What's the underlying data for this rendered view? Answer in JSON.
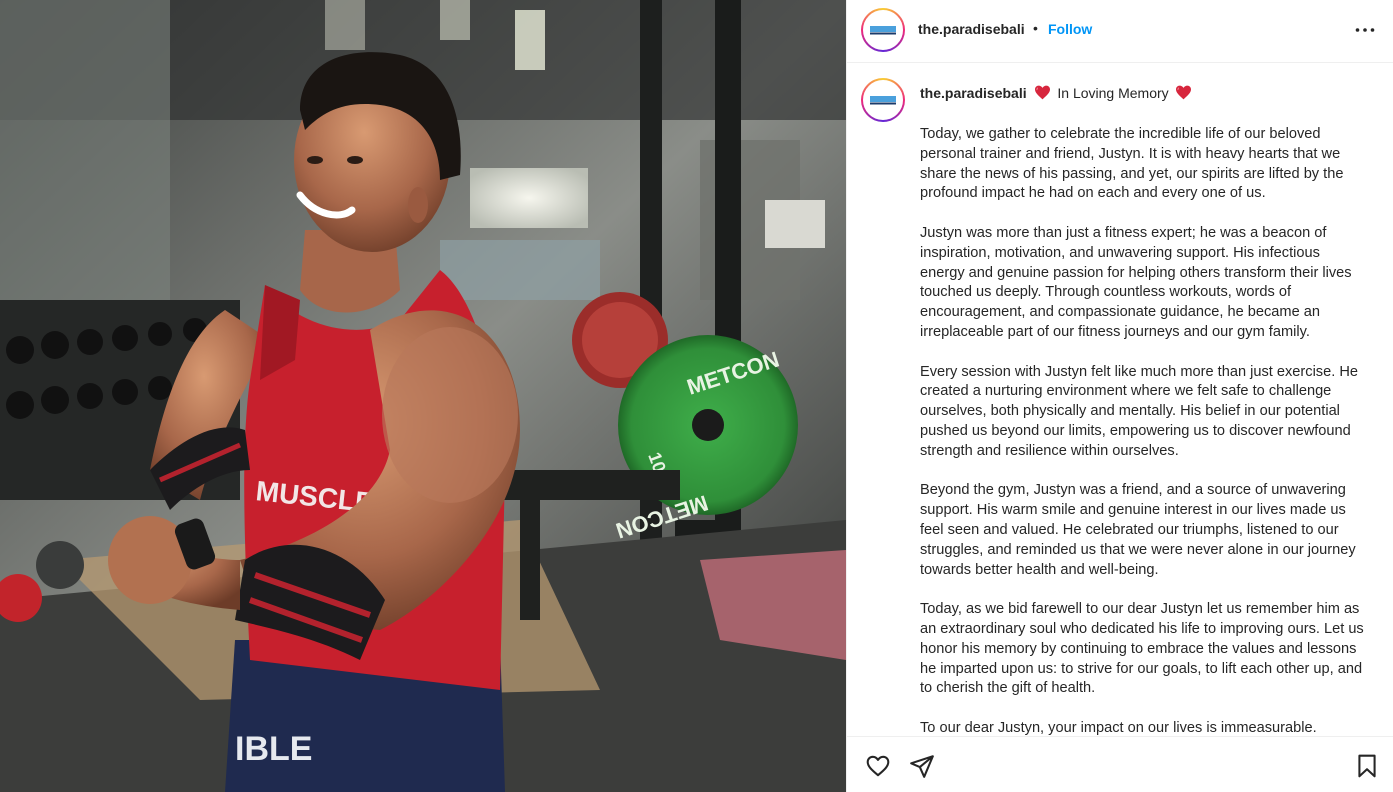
{
  "post": {
    "username": "the.paradisebali",
    "separator": "•",
    "follow_label": "Follow",
    "avatar_logo_text": "PARADISE",
    "photo_shirt_text": "MUSCLE",
    "photo_shorts_text": "IBLE",
    "photo_plate_text": "METCON",
    "photo_plate_number": "10",
    "caption": {
      "username": "the.paradisebali",
      "title": "In Loving Memory",
      "paragraphs": [
        "Today, we gather to celebrate the incredible life of our beloved personal trainer and friend, Justyn. It is with heavy hearts that we share the news of his passing, and yet, our spirits are lifted by the profound impact he had on each and every one of us.",
        "Justyn was more than just a fitness expert; he was a beacon of inspiration, motivation, and unwavering support. His infectious energy and genuine passion for helping others transform their lives touched us deeply. Through countless workouts, words of encouragement, and compassionate guidance, he became an irreplaceable part of our fitness journeys and our gym family.",
        "Every session with Justyn felt like much more than just exercise. He created a nurturing environment where we felt safe to challenge ourselves, both physically and mentally. His belief in our potential pushed us beyond our limits, empowering us to discover newfound strength and resilience within ourselves.",
        "Beyond the gym, Justyn was a friend, and a source of unwavering support. His warm smile and genuine interest in our lives made us feel seen and valued. He celebrated our triumphs, listened to our struggles, and reminded us that we were never alone in our journey towards better health and well-being.",
        "Today, as we bid farewell to our dear Justyn let us remember him as an extraordinary soul who dedicated his life to improving ours. Let us honor his memory by continuing to embrace the values and lessons he imparted upon us: to strive for our goals, to lift each other up, and to cherish the gift of health.",
        "To our dear Justyn, your impact on our lives is immeasurable."
      ]
    },
    "icons": {
      "more": "more-horizontal-icon",
      "like": "heart-outline-icon",
      "share": "paper-plane-icon",
      "save": "bookmark-outline-icon",
      "heart_emoji": "red-heart-emoji"
    },
    "colors": {
      "link": "#0095f6",
      "text": "#262626",
      "divider": "#efefef",
      "heart": "#d7263d"
    }
  }
}
